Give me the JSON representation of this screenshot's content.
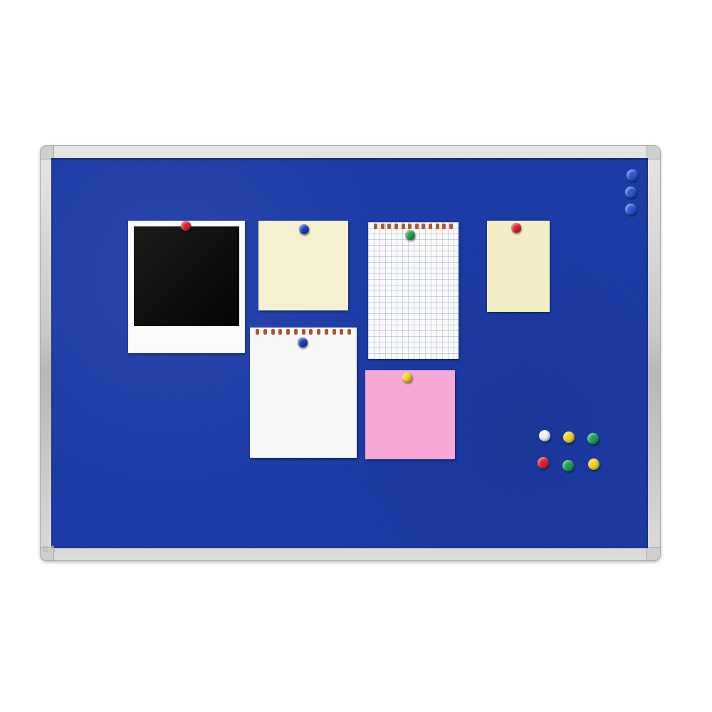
{
  "scene": {
    "board_color": "#1a3aa8",
    "frame_color": "#c9c9c6",
    "background_color": "#ffffff"
  },
  "brand": {
    "text": "BA"
  },
  "papers": [
    {
      "name": "polaroid-photo",
      "color": "#fbfbfb",
      "pin_color": "#e3202a"
    },
    {
      "name": "sticky-note-cream",
      "color": "#f5f0cf",
      "pin_color": "#1d3db8"
    },
    {
      "name": "grid-paper",
      "color": "#fafafa",
      "pin_color": "#1fa34a"
    },
    {
      "name": "sticky-note-cream-small",
      "color": "#f3eec5",
      "pin_color": "#e3202a"
    },
    {
      "name": "notebook-paper",
      "color": "#f8f8f8",
      "pin_color": "#1d3db8"
    },
    {
      "name": "sticky-note-pink",
      "color": "#f7a8d4",
      "pin_color": "#f2d21d"
    }
  ],
  "loose_pins": [
    {
      "color": "#f2f2f2"
    },
    {
      "color": "#f2d21d"
    },
    {
      "color": "#1fa34a"
    },
    {
      "color": "#e3202a"
    },
    {
      "color": "#1fa34a"
    },
    {
      "color": "#f2d21d"
    }
  ],
  "push_pins": [
    {
      "color": "#2a55d6"
    },
    {
      "color": "#2a55d6"
    },
    {
      "color": "#2a55d6"
    }
  ]
}
